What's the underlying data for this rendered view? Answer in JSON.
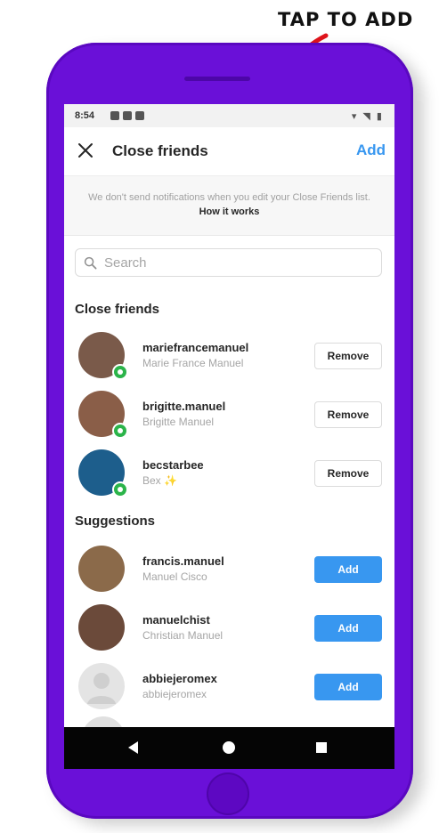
{
  "annotation": {
    "text": "TAP TO ADD",
    "arrow_color": "#e0141c"
  },
  "phone": {
    "body_color": "#6a10d8"
  },
  "status_bar": {
    "time": "8:54",
    "trailing": "▾ ◥ ▮"
  },
  "header": {
    "title": "Close friends",
    "action_label": "Add",
    "accent_color": "#3897f0"
  },
  "notice": {
    "text": "We don't send notifications when you edit your Close Friends list.",
    "link": "How it works"
  },
  "search": {
    "placeholder": "Search"
  },
  "close_friends": {
    "title": "Close friends",
    "button_label": "Remove",
    "items": [
      {
        "username": "mariefrancemanuel",
        "full_name": "Marie France Manuel",
        "avatar_color": "#7a5a4a"
      },
      {
        "username": "brigitte.manuel",
        "full_name": "Brigitte Manuel",
        "avatar_color": "#8a5e48"
      },
      {
        "username": "becstarbee",
        "full_name": "Bex ✨",
        "avatar_color": "#1d5e8c"
      }
    ]
  },
  "suggestions": {
    "title": "Suggestions",
    "button_label": "Add",
    "items": [
      {
        "username": "francis.manuel",
        "full_name": "Manuel Cisco",
        "avatar_color": "#8b6a4a"
      },
      {
        "username": "manuelchist",
        "full_name": "Christian Manuel",
        "avatar_color": "#6b4a3a"
      },
      {
        "username": "abbiejeromex",
        "full_name": "abbiejeromex",
        "avatar_color": "#e4e4e4"
      }
    ]
  },
  "nav": {
    "back": "back-icon",
    "home": "home-icon",
    "recents": "recents-icon"
  }
}
